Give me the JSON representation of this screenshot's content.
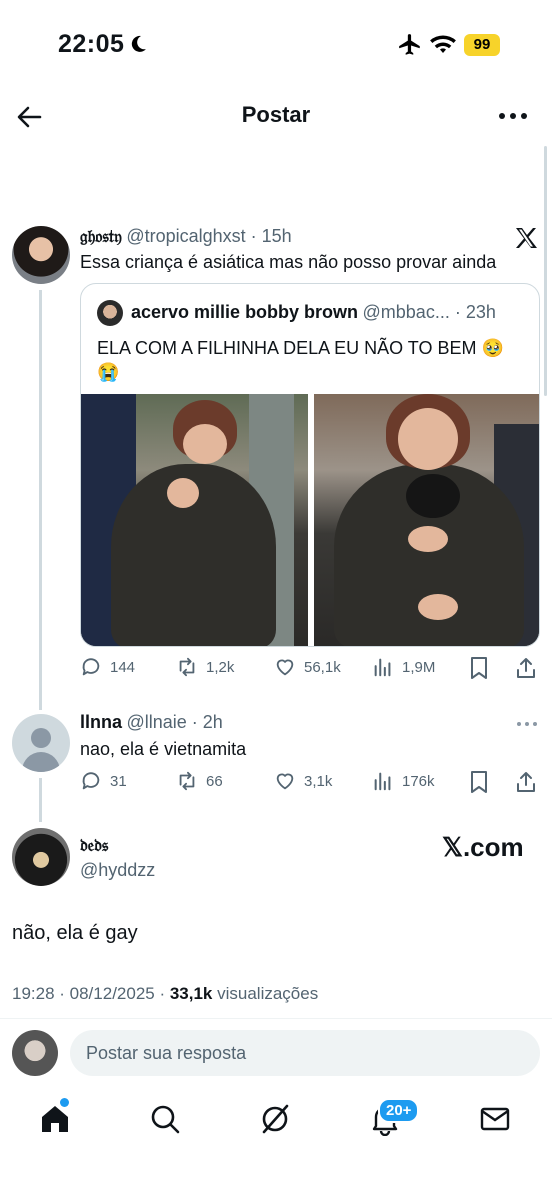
{
  "status_bar": {
    "time": "22:05",
    "battery": "99"
  },
  "header": {
    "title": "Postar"
  },
  "post1": {
    "display_name": "𝔤𝔥𝔬𝔰𝔱𝔶",
    "handle": "@tropicalghxst",
    "age": "15h",
    "text": "Essa criança é asiática mas não posso provar ainda"
  },
  "quote": {
    "display_name": "acervo millie bobby brown",
    "handle": "@mbbac...",
    "age": "23h",
    "text_line1": "ELA COM A FILHINHA DELA EU NÃO TO BEM 🥹",
    "text_line2": "😭"
  },
  "post1_actions": {
    "replies": "144",
    "reposts": "1,2k",
    "likes": "56,1k",
    "views": "1,9M"
  },
  "post2": {
    "display_name": "llnna",
    "handle": "@llnaie",
    "age": "2h",
    "text": "nao, ela é vietnamita"
  },
  "post2_actions": {
    "replies": "31",
    "reposts": "66",
    "likes": "3,1k",
    "views": "176k"
  },
  "main_post": {
    "display_name": "𝔡𝔢𝔡𝔰",
    "handle": "@hyddzz",
    "text": "não, ela é gay",
    "timestamp": "19:28 · 08/12/2025 · ",
    "views_count": "33,1k",
    "views_label": " visualizações"
  },
  "watermark": "𝕏.com",
  "reply_box": {
    "placeholder": "Postar sua resposta"
  },
  "nav": {
    "notifications_badge": "20+"
  },
  "colors": {
    "accent": "#1d9bf0",
    "muted": "#536471",
    "divider": "#cfd9de"
  }
}
